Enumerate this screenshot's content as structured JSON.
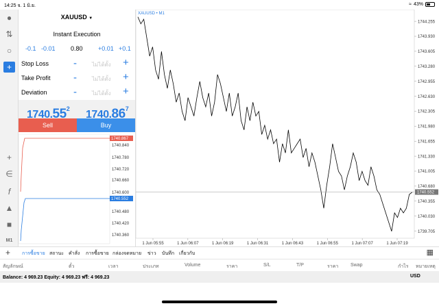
{
  "status": {
    "time": "14:25",
    "date": "จ. 1 มิ.ย.",
    "battery": "43%"
  },
  "panel": {
    "symbol": "XAUUSD",
    "mode": "Instant Execution",
    "steps": [
      "-0.1",
      "-0.01",
      "0.80",
      "+0.01",
      "+0.1"
    ],
    "rows": [
      {
        "label": "Stop Loss",
        "placeholder": "ไม่ได้ตั้ง"
      },
      {
        "label": "Take Profit",
        "placeholder": "ไม่ได้ตั้ง"
      },
      {
        "label": "Deviation",
        "placeholder": "ไม่ได้ตั้ง"
      }
    ],
    "sell_price": {
      "main": "1740.",
      "big": "55",
      "small": "2"
    },
    "buy_price": {
      "main": "1740.",
      "big": "86",
      "small": "7"
    },
    "sell_label": "Sell",
    "buy_label": "Buy"
  },
  "tick_chart": {
    "ask_label": "1740.867",
    "bid_label": "1740.552",
    "yticks": [
      "1740.840",
      "1740.780",
      "1740.720",
      "1740.660",
      "1740.600",
      "1740.540",
      "1740.480",
      "1740.420",
      "1740.360"
    ]
  },
  "chart_data": {
    "type": "line",
    "title": "XAUUSD • M1",
    "x": [
      "1 Jun 05:55",
      "1 Jun 06:07",
      "1 Jun 06:19",
      "1 Jun 06:31",
      "1 Jun 06:43",
      "1 Jun 06:55",
      "1 Jun 07:07",
      "1 Jun 07:19"
    ],
    "yticks": [
      "1744.255",
      "1743.930",
      "1743.605",
      "1743.280",
      "1742.955",
      "1742.630",
      "1742.305",
      "1741.980",
      "1741.655",
      "1741.330",
      "1741.005",
      "1740.680",
      "1740.355",
      "1740.030",
      "1739.705"
    ],
    "ylim": [
      1739.55,
      1744.45
    ],
    "current_price": "1740.552",
    "current_value": 1740.552,
    "values": [
      1744.35,
      1744.2,
      1744.3,
      1743.9,
      1743.5,
      1743.7,
      1743.2,
      1743.0,
      1743.6,
      1743.1,
      1742.8,
      1743.2,
      1742.9,
      1742.5,
      1742.7,
      1742.3,
      1742.1,
      1742.6,
      1742.4,
      1742.2,
      1742.6,
      1742.95,
      1742.6,
      1742.4,
      1742.7,
      1742.2,
      1742.5,
      1743.1,
      1742.9,
      1742.6,
      1742.3,
      1742.7,
      1742.2,
      1742.4,
      1742.7,
      1742.1,
      1741.9,
      1742.4,
      1742.1,
      1742.5,
      1742.2,
      1742.3,
      1741.8,
      1742.0,
      1741.7,
      1741.9,
      1741.6,
      1741.7,
      1741.2,
      1741.6,
      1741.4,
      1741.9,
      1741.4,
      1741.5,
      1741.6,
      1741.7,
      1741.3,
      1741.5,
      1741.1,
      1741.4,
      1741.2,
      1740.9,
      1740.6,
      1740.2,
      1740.7,
      1741.1,
      1741.6,
      1741.3,
      1741.0,
      1740.9,
      1740.6,
      1740.9,
      1741.1,
      1741.4,
      1741.2,
      1740.8,
      1741.0,
      1740.8,
      1740.7,
      1741.1,
      1740.9,
      1740.6,
      1740.5,
      1740.3,
      1740.1,
      1739.9,
      1739.7,
      1740.1,
      1740.0,
      1740.2,
      1740.1,
      1740.2,
      1740.5,
      1740.55
    ]
  },
  "tabs": [
    "การซื้อขาย",
    "สถานะ",
    "คำสั่ง",
    "การซื้อขาย",
    "กล่องจดหมาย",
    "ข่าว",
    "บันทึก",
    "เกี่ยวกับ"
  ],
  "columns": [
    "สัญลักษณ์",
    "ตั๋ว",
    "เวลา",
    "ประเภท",
    "Volume",
    "ราคา",
    "S/L",
    "T/P",
    "ราคา",
    "Swap",
    "กำไร",
    "หมายเหตุ"
  ],
  "balance": "Balance: 4 969.23 Equity: 4 969.23 ฟรี: 4 969.23",
  "currency": "USD"
}
